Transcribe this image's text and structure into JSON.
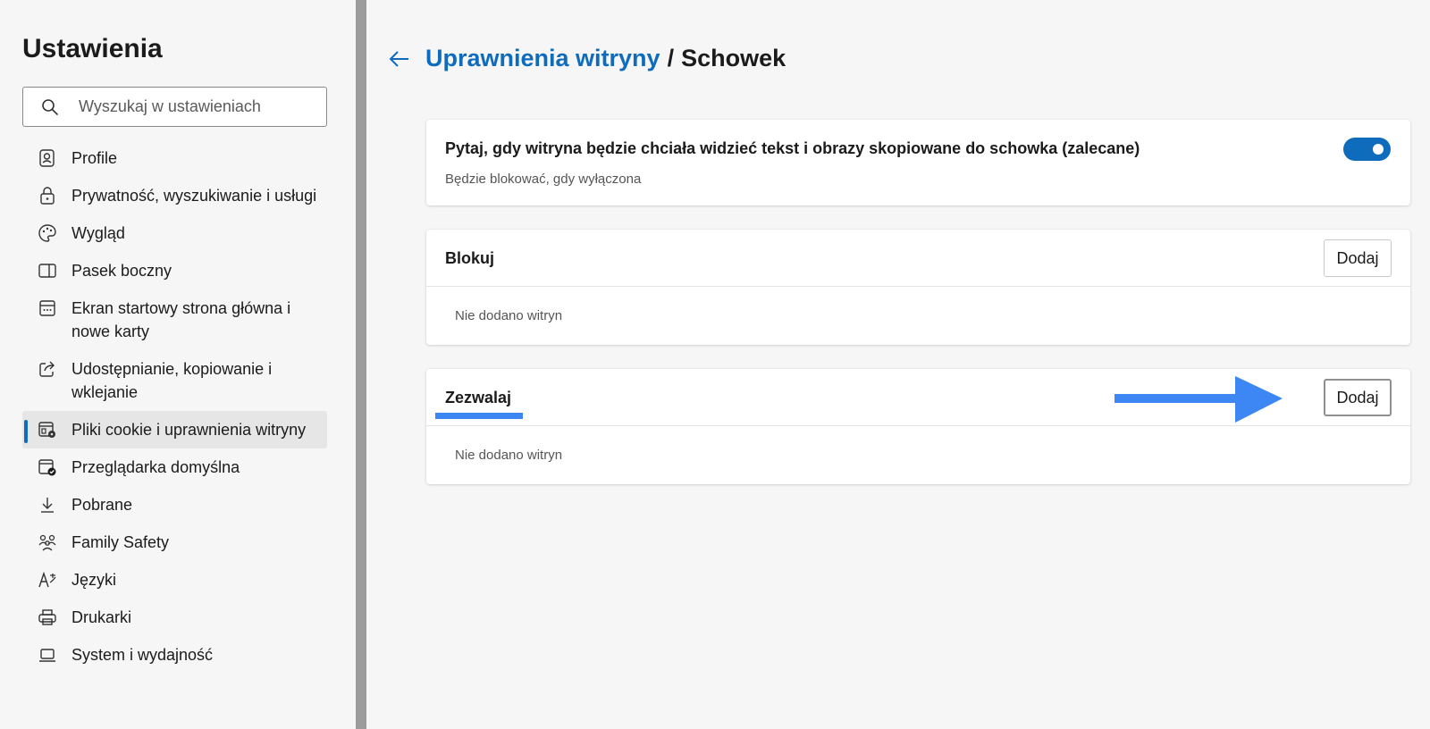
{
  "sidebar": {
    "title": "Ustawienia",
    "search": {
      "placeholder": "Wyszukaj w ustawieniach",
      "value": ""
    },
    "items": [
      {
        "label": "Profile",
        "icon": "profile-icon"
      },
      {
        "label": "Prywatność, wyszukiwanie i usługi",
        "icon": "lock-icon"
      },
      {
        "label": "Wygląd",
        "icon": "palette-icon"
      },
      {
        "label": "Pasek boczny",
        "icon": "sidebar-icon"
      },
      {
        "label": "Ekran startowy strona główna i nowe karty",
        "icon": "home-grid-icon"
      },
      {
        "label": "Udostępnianie, kopiowanie i wklejanie",
        "icon": "share-icon"
      },
      {
        "label": "Pliki cookie i uprawnienia witryny",
        "icon": "cookie-settings-icon",
        "active": true
      },
      {
        "label": "Przeglądarka domyślna",
        "icon": "default-browser-icon"
      },
      {
        "label": "Pobrane",
        "icon": "download-icon"
      },
      {
        "label": "Family Safety",
        "icon": "family-icon"
      },
      {
        "label": "Języki",
        "icon": "language-icon"
      },
      {
        "label": "Drukarki",
        "icon": "printer-icon"
      },
      {
        "label": "System i wydajność",
        "icon": "laptop-icon"
      }
    ]
  },
  "header": {
    "breadcrumb_link": "Uprawnienia witryny",
    "separator": "/",
    "current": "Schowek"
  },
  "ask_card": {
    "title": "Pytaj, gdy witryna będzie chciała widzieć tekst i obrazy skopiowane do schowka (zalecane)",
    "subtitle": "Będzie blokować, gdy wyłączona",
    "toggle_on": true
  },
  "block_card": {
    "label": "Blokuj",
    "add_label": "Dodaj",
    "empty_text": "Nie dodano witryn"
  },
  "allow_card": {
    "label": "Zezwalaj",
    "add_label": "Dodaj",
    "empty_text": "Nie dodano witryn"
  },
  "colors": {
    "accent": "#0f6cbd",
    "annotation": "#3d87f5"
  }
}
